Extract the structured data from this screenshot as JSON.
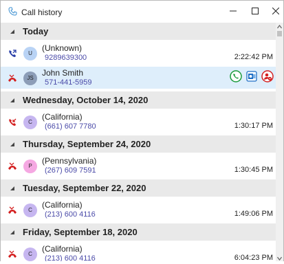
{
  "window": {
    "title": "Call history",
    "icon": "phone-history-icon",
    "minimize_icon": "minimize-icon",
    "maximize_icon": "maximize-icon",
    "close_icon": "close-icon"
  },
  "colors": {
    "group_header_bg": "#e9e9e9",
    "selected_row_bg": "#deeefb",
    "number_text": "#4a4aa8",
    "outgoing_icon": "#2a3fa8",
    "missed_icon": "#d42020",
    "call_action": "#1a9a3a",
    "outlook_action": "#1f6fc5",
    "block_action": "#d42020"
  },
  "groups": [
    {
      "label": "Today",
      "calls": [
        {
          "type": "outgoing",
          "avatar": "U",
          "avatar_color": "#b9d3f5",
          "name": "(Unknown)",
          "number": "9289639300",
          "time": "2:22:42 PM",
          "selected": false
        },
        {
          "type": "missed",
          "avatar": "JS",
          "avatar_color": "#8c9db7",
          "name": "John Smith",
          "number": "571-441-5959",
          "time": "",
          "selected": true
        }
      ]
    },
    {
      "label": "Wednesday, October 14, 2020",
      "calls": [
        {
          "type": "incoming-missed",
          "avatar": "C",
          "avatar_color": "#c6b6f0",
          "name": "(California)",
          "number": "(661) 607 7780",
          "time": "1:30:17 PM",
          "selected": false
        }
      ]
    },
    {
      "label": "Thursday, September 24, 2020",
      "calls": [
        {
          "type": "missed",
          "avatar": "P",
          "avatar_color": "#f5a8e2",
          "name": "(Pennsylvania)",
          "number": "(267) 609 7591",
          "time": "1:30:45 PM",
          "selected": false
        }
      ]
    },
    {
      "label": "Tuesday, September 22, 2020",
      "calls": [
        {
          "type": "missed",
          "avatar": "C",
          "avatar_color": "#c6b6f0",
          "name": "(California)",
          "number": "(213) 600 4116",
          "time": "1:49:06 PM",
          "selected": false
        }
      ]
    },
    {
      "label": "Friday, September 18, 2020",
      "calls": [
        {
          "type": "missed",
          "avatar": "C",
          "avatar_color": "#c6b6f0",
          "name": "(California)",
          "number": "(213) 600 4116",
          "time": "6:04:23 PM",
          "selected": false
        }
      ]
    }
  ],
  "row_actions": [
    {
      "name": "call-back-icon"
    },
    {
      "name": "outlook-icon"
    },
    {
      "name": "block-contact-icon"
    }
  ]
}
